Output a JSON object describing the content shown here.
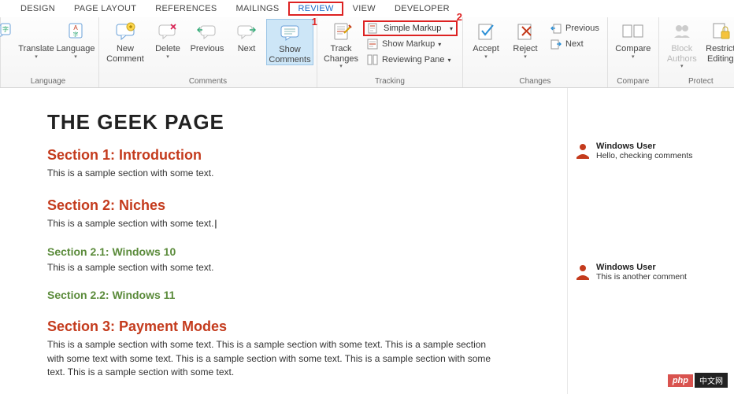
{
  "tabs": {
    "design": "DESIGN",
    "layout": "PAGE LAYOUT",
    "references": "REFERENCES",
    "mailings": "MAILINGS",
    "review": "REVIEW",
    "view": "VIEW",
    "developer": "DEVELOPER"
  },
  "ribbon": {
    "translate": "Translate",
    "language": "Language",
    "group_language": "Language",
    "new_comment": "New\nComment",
    "delete": "Delete",
    "previous": "Previous",
    "next": "Next",
    "show_comments": "Show\nComments",
    "group_comments": "Comments",
    "track_changes": "Track\nChanges",
    "markup_select": "Simple Markup",
    "show_markup": "Show Markup",
    "reviewing_pane": "Reviewing Pane",
    "group_tracking": "Tracking",
    "accept": "Accept",
    "reject": "Reject",
    "prev2": "Previous",
    "next2": "Next",
    "group_changes": "Changes",
    "compare": "Compare",
    "group_compare": "Compare",
    "block_authors": "Block\nAuthors",
    "restrict_editing": "Restrict\nEditing",
    "group_protect": "Protect"
  },
  "callouts": {
    "one": "1",
    "two": "2"
  },
  "doc": {
    "title": "THE GEEK PAGE",
    "s1": "Section 1: Introduction",
    "t1": "This is a sample section with some text.",
    "s2": "Section 2: Niches",
    "t2": "This is a sample section with some text.",
    "s21": "Section 2.1: Windows 10",
    "t21": "This is a sample section with some text.",
    "s22": "Section 2.2: Windows 11",
    "s3": "Section 3: Payment Modes",
    "t3": "This is a sample section with some text. This is a sample section with some text. This is a sample section with some text with some text. This is a sample section with some text. This is a sample section with some text. This is a sample section with some text."
  },
  "comments": [
    {
      "user": "Windows User",
      "text": "Hello, checking comments"
    },
    {
      "user": "Windows User",
      "text": "This is another comment"
    }
  ],
  "wm": {
    "a": "php",
    "b": "中文网"
  }
}
